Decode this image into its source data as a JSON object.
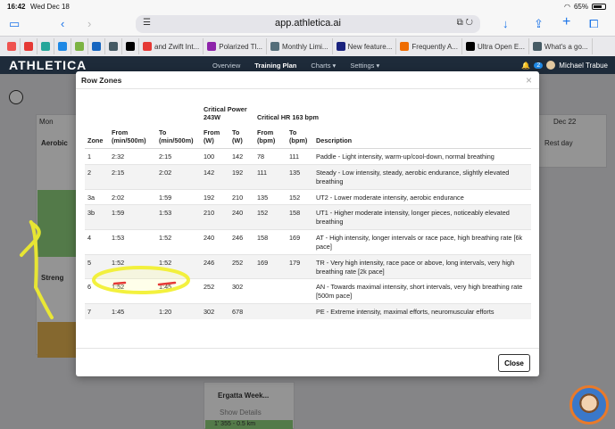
{
  "status": {
    "time": "16:42",
    "date": "Wed Dec 18",
    "battery": "65%"
  },
  "browser": {
    "url": "app.athletica.ai",
    "tabs": [
      {
        "label": "",
        "color": "#ef5350"
      },
      {
        "label": "",
        "color": "#e53935"
      },
      {
        "label": "",
        "color": "#26a69a"
      },
      {
        "label": "",
        "color": "#1e88e5"
      },
      {
        "label": "",
        "color": "#7cb342"
      },
      {
        "label": "",
        "color": "#1565c0"
      },
      {
        "label": "",
        "color": "#455a64"
      },
      {
        "label": "",
        "color": "#000000"
      },
      {
        "label": "and Zwift Int...",
        "color": "#e53935"
      },
      {
        "label": "Polarized Tl...",
        "color": "#8e24aa"
      },
      {
        "label": "Monthly Limi...",
        "color": "#546e7a"
      },
      {
        "label": "New feature...",
        "color": "#1a237e"
      },
      {
        "label": "Frequently A...",
        "color": "#ef6c00"
      },
      {
        "label": "Ultra Open E...",
        "color": "#000000"
      },
      {
        "label": "What's a go...",
        "color": "#455a64"
      }
    ]
  },
  "app": {
    "logo": "ATHLETICA",
    "nav": [
      "Overview",
      "Training Plan",
      "Charts ▾",
      "Settings ▾"
    ],
    "user": "Michael Trabue",
    "notif_count": "2"
  },
  "background": {
    "days": [
      "Mon",
      "Dec 22"
    ],
    "rest_day": "Rest day",
    "card1_title": "Aerobic",
    "card2_title": "Streng",
    "card3_title": "Ergatta Week...",
    "show_details": "Show Details",
    "bottom_metric": "1' 355 - 0.5 km"
  },
  "modal": {
    "title": "Row Zones",
    "group_headers": {
      "critical_power": "Critical Power",
      "cp_value": "243W",
      "critical_hr": "Critical HR 163 bpm"
    },
    "columns": [
      "Zone",
      "From (min/500m)",
      "To (min/500m)",
      "From (W)",
      "To (W)",
      "From (bpm)",
      "To (bpm)",
      "Description"
    ],
    "rows": [
      {
        "zone": "1",
        "from_pace": "2:32",
        "to_pace": "2:15",
        "from_w": "100",
        "to_w": "142",
        "from_bpm": "78",
        "to_bpm": "111",
        "desc": "Paddle - Light intensity, warm-up/cool-down, normal breathing"
      },
      {
        "zone": "2",
        "from_pace": "2:15",
        "to_pace": "2:02",
        "from_w": "142",
        "to_w": "192",
        "from_bpm": "111",
        "to_bpm": "135",
        "desc": "Steady - Low intensity, steady, aerobic endurance, slightly elevated breathing"
      },
      {
        "zone": "3a",
        "from_pace": "2:02",
        "to_pace": "1:59",
        "from_w": "192",
        "to_w": "210",
        "from_bpm": "135",
        "to_bpm": "152",
        "desc": "UT2 - Lower moderate intensity, aerobic endurance"
      },
      {
        "zone": "3b",
        "from_pace": "1:59",
        "to_pace": "1:53",
        "from_w": "210",
        "to_w": "240",
        "from_bpm": "152",
        "to_bpm": "158",
        "desc": "UT1 - Higher moderate intensity, longer pieces, noticeably elevated breathing"
      },
      {
        "zone": "4",
        "from_pace": "1:53",
        "to_pace": "1:52",
        "from_w": "240",
        "to_w": "246",
        "from_bpm": "158",
        "to_bpm": "169",
        "desc": "AT - High intensity, longer intervals or race pace, high breathing rate [6k pace]"
      },
      {
        "zone": "5",
        "from_pace": "1:52",
        "to_pace": "1:52",
        "from_w": "246",
        "to_w": "252",
        "from_bpm": "169",
        "to_bpm": "179",
        "desc": "TR - Very high intensity, race pace or above, long intervals, very high breathing rate [2k pace]"
      },
      {
        "zone": "6",
        "from_pace": "1:52",
        "to_pace": "1:45",
        "from_w": "252",
        "to_w": "302",
        "from_bpm": "",
        "to_bpm": "",
        "desc": "AN - Towards maximal intensity, short intervals, very high breathing rate [500m pace]"
      },
      {
        "zone": "7",
        "from_pace": "1:45",
        "to_pace": "1:20",
        "from_w": "302",
        "to_w": "678",
        "from_bpm": "",
        "to_bpm": "",
        "desc": "PE - Extreme intensity, maximal efforts, neuromuscular efforts"
      }
    ],
    "close_label": "Close"
  }
}
